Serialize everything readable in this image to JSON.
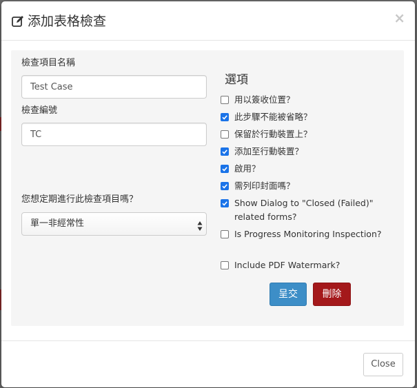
{
  "modal": {
    "title": "添加表格檢查",
    "close_symbol": "×"
  },
  "form": {
    "name_label": "檢查項目名稱",
    "name_value": "Test Case",
    "number_label": "檢查編號",
    "number_value": "TC",
    "schedule_label": "您想定期進行此檢查項目嗎？",
    "schedule_value": "單一非經常性"
  },
  "options": {
    "title": "選項",
    "items": [
      {
        "label": "用以簽收位置？",
        "checked": false
      },
      {
        "label": "此步驟不能被省略？",
        "checked": true
      },
      {
        "label": "保留於行動裝置上？",
        "checked": false
      },
      {
        "label": "添加至行動裝置？",
        "checked": true
      },
      {
        "label": "啟用？",
        "checked": true
      },
      {
        "label": "需列印封面嗎？",
        "checked": true
      },
      {
        "label": "Show Dialog to \"Closed (Failed)\" related forms?",
        "checked": true
      },
      {
        "label": "Is Progress Monitoring Inspection?",
        "checked": false
      },
      {
        "label": "Include PDF Watermark?",
        "checked": false
      }
    ]
  },
  "buttons": {
    "submit": "呈交",
    "delete": "刪除",
    "close": "Close"
  },
  "colors": {
    "submit_bg": "#3d8ec7",
    "delete_bg": "#a4191b",
    "checkbox_checked": "#1a73e8",
    "panel_bg": "#f5f5f5"
  },
  "icons": {
    "title_icon": "edit-icon",
    "close": "close-icon",
    "select": "select-arrows-icon",
    "check": "checkmark-icon"
  }
}
